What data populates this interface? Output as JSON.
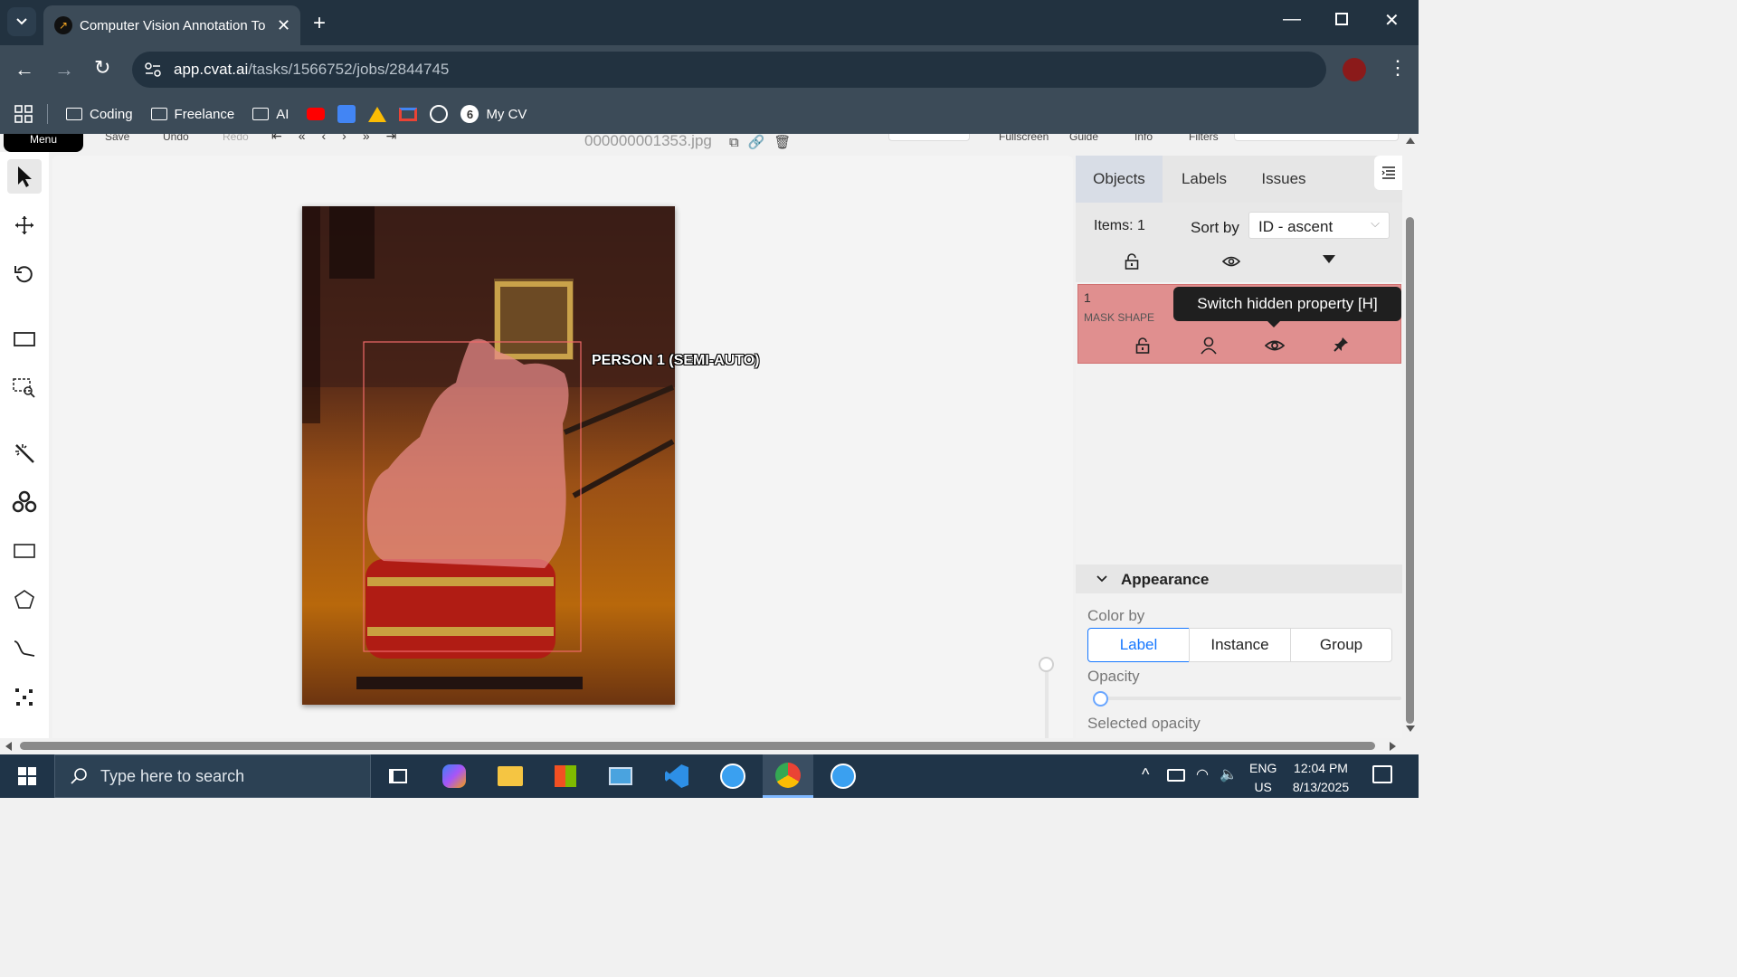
{
  "browser": {
    "tab_title": "Computer Vision Annotation To",
    "url_domain": "app.cvat.ai",
    "url_path": "/tasks/1566752/jobs/2844745",
    "bookmarks": [
      {
        "label": "Coding"
      },
      {
        "label": "Freelance"
      },
      {
        "label": "AI"
      },
      {
        "label": "My CV"
      }
    ]
  },
  "cvat_toolbar": {
    "menu": "Menu",
    "save": "Save",
    "undo": "Undo",
    "redo": "Redo",
    "filename": "000000001353.jpg",
    "fullscreen": "Fullscreen",
    "guide": "Guide",
    "info": "Info",
    "filters": "Filters"
  },
  "canvas": {
    "object_label": "PERSON 1 (SEMI-AUTO)"
  },
  "sidebar": {
    "tabs": [
      "Objects",
      "Labels",
      "Issues"
    ],
    "items_count": "Items: 1",
    "sort_by_label": "Sort by",
    "sort_value": "ID - ascent",
    "object": {
      "id": "1",
      "type": "MASK SHAPE",
      "tooltip": "Switch hidden property [H]",
      "color": "#e08f8f"
    },
    "appearance": {
      "title": "Appearance",
      "color_by_label": "Color by",
      "color_by_options": [
        "Label",
        "Instance",
        "Group"
      ],
      "selected_option": "Label",
      "opacity_label": "Opacity",
      "selected_opacity_label": "Selected opacity"
    }
  },
  "taskbar": {
    "search_placeholder": "Type here to search",
    "language": "ENG",
    "region": "US",
    "time": "12:04 PM",
    "date": "8/13/2025"
  },
  "colors": {
    "accent": "#1677ff",
    "mask": "#e08f8f",
    "chrome_dark": "#223240",
    "chrome_mid": "#3c4b58"
  }
}
